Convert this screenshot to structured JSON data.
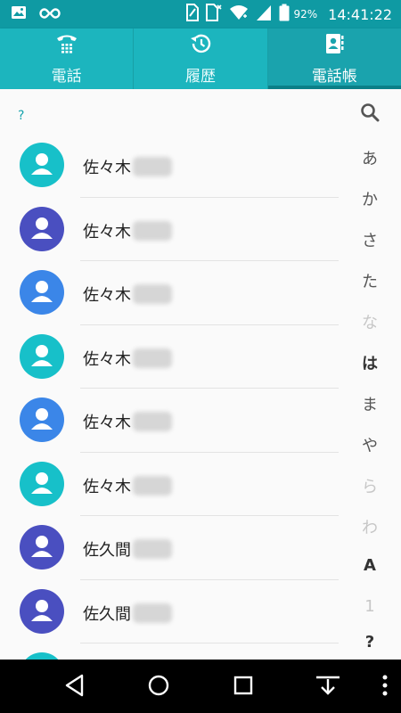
{
  "status": {
    "left_icons": [
      "image-icon",
      "infinity-icon"
    ],
    "right_icons": [
      "sim-icon",
      "sim-cross-icon",
      "wifi-icon",
      "signal-icon",
      "battery-icon"
    ],
    "battery": "92%",
    "time": "14:41:22"
  },
  "tabs": [
    {
      "label": "電話",
      "icon": "phone-dialpad-icon",
      "active": false
    },
    {
      "label": "履歴",
      "icon": "history-icon",
      "active": false
    },
    {
      "label": "電話帳",
      "icon": "contacts-book-icon",
      "active": true
    }
  ],
  "list": {
    "section_header": "?",
    "contacts": [
      {
        "name": "佐々木",
        "color": "#17c0c9"
      },
      {
        "name": "佐々木",
        "color": "#4a4fc0"
      },
      {
        "name": "佐々木",
        "color": "#3b86e8"
      },
      {
        "name": "佐々木",
        "color": "#17c0c9"
      },
      {
        "name": "佐々木",
        "color": "#3b86e8"
      },
      {
        "name": "佐々木",
        "color": "#17c0c9"
      },
      {
        "name": "佐久間",
        "color": "#4a4fc0"
      },
      {
        "name": "佐久間",
        "color": "#4a4fc0"
      },
      {
        "name": "",
        "color": "#17c0c9"
      }
    ]
  },
  "index_bar": {
    "search_icon": "search-icon",
    "letters": [
      "あ",
      "か",
      "さ",
      "た",
      "な",
      "は",
      "ま",
      "や",
      "ら",
      "わ",
      "A",
      "1",
      "?"
    ],
    "dim_letters": [
      "な",
      "ら",
      "わ"
    ],
    "bold_letters": [
      "は",
      "A",
      "1",
      "?"
    ]
  },
  "navbar": {
    "icons": [
      "back-icon",
      "home-icon",
      "recents-icon",
      "notification-pull-icon",
      "menu-icon"
    ]
  },
  "colors": {
    "status_bar": "#0f9aa3",
    "tab_bar": "#1cb5be",
    "tab_active": "#1aa3ad",
    "accent": "#17a3ad"
  }
}
